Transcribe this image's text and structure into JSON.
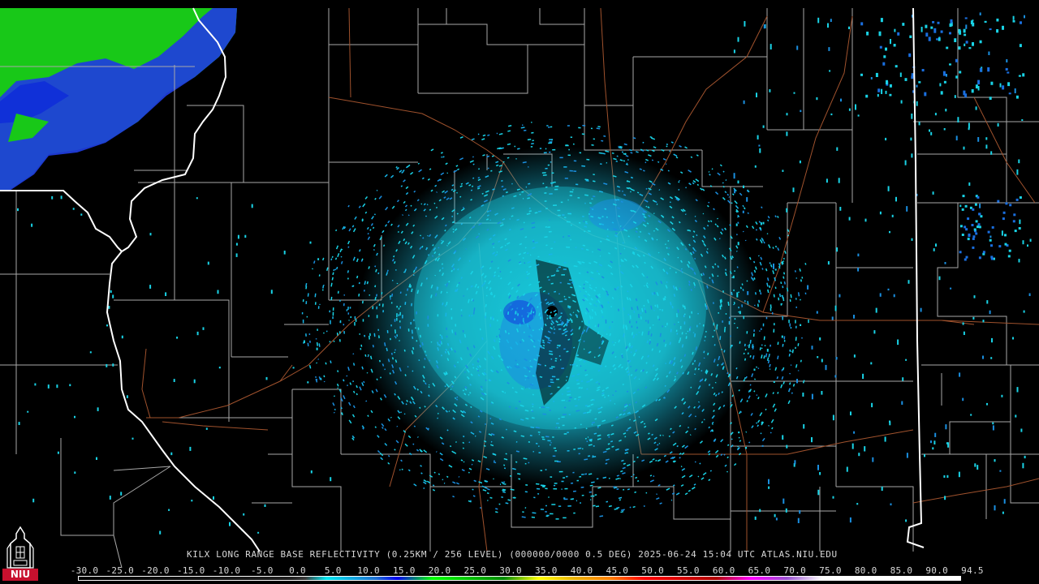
{
  "product": {
    "caption": "KILX LONG RANGE BASE REFLECTIVITY (0.25KM / 256 LEVEL) (000000/0000 0.5 DEG) 2025-06-24 15:04 UTC  ATLAS.NIU.EDU"
  },
  "logo": {
    "text": "NIU",
    "icon": "university-tower-icon"
  },
  "scale": {
    "labels": [
      "-30.0",
      "-25.0",
      "-20.0",
      "-15.0",
      "-10.0",
      "-5.0",
      "0.0",
      "5.0",
      "10.0",
      "15.0",
      "20.0",
      "25.0",
      "30.0",
      "35.0",
      "40.0",
      "45.0",
      "50.0",
      "55.0",
      "60.0",
      "65.0",
      "70.0",
      "75.0",
      "80.0",
      "85.0",
      "90.0",
      "94.5"
    ],
    "stops": [
      {
        "v": -30,
        "color": "#000000"
      },
      {
        "v": 0,
        "color": "#202020"
      },
      {
        "v": 2,
        "color": "#3a3a3a"
      },
      {
        "v": 5,
        "color": "#00e5ee"
      },
      {
        "v": 12,
        "color": "#1e6fd0"
      },
      {
        "v": 15,
        "color": "#0000f0"
      },
      {
        "v": 20,
        "color": "#00ff00"
      },
      {
        "v": 30,
        "color": "#008a00"
      },
      {
        "v": 35,
        "color": "#ffff00"
      },
      {
        "v": 40,
        "color": "#e8b000"
      },
      {
        "v": 45,
        "color": "#ff8000"
      },
      {
        "v": 50,
        "color": "#ff0000"
      },
      {
        "v": 60,
        "color": "#b00000"
      },
      {
        "v": 65,
        "color": "#ff00ff"
      },
      {
        "v": 70,
        "color": "#9a50d0"
      },
      {
        "v": 75,
        "color": "#ffffff"
      },
      {
        "v": 94.5,
        "color": "#ffffff"
      }
    ]
  },
  "colors": {
    "background": "#000000",
    "county_lines": "#a8a8a8",
    "state_lines": "#ffffff",
    "highways": "#a0522d",
    "echo_light": "#19d3e6",
    "echo_mid": "#1a8fe0",
    "echo_blue": "#1030e0",
    "echo_green": "#10d030"
  }
}
